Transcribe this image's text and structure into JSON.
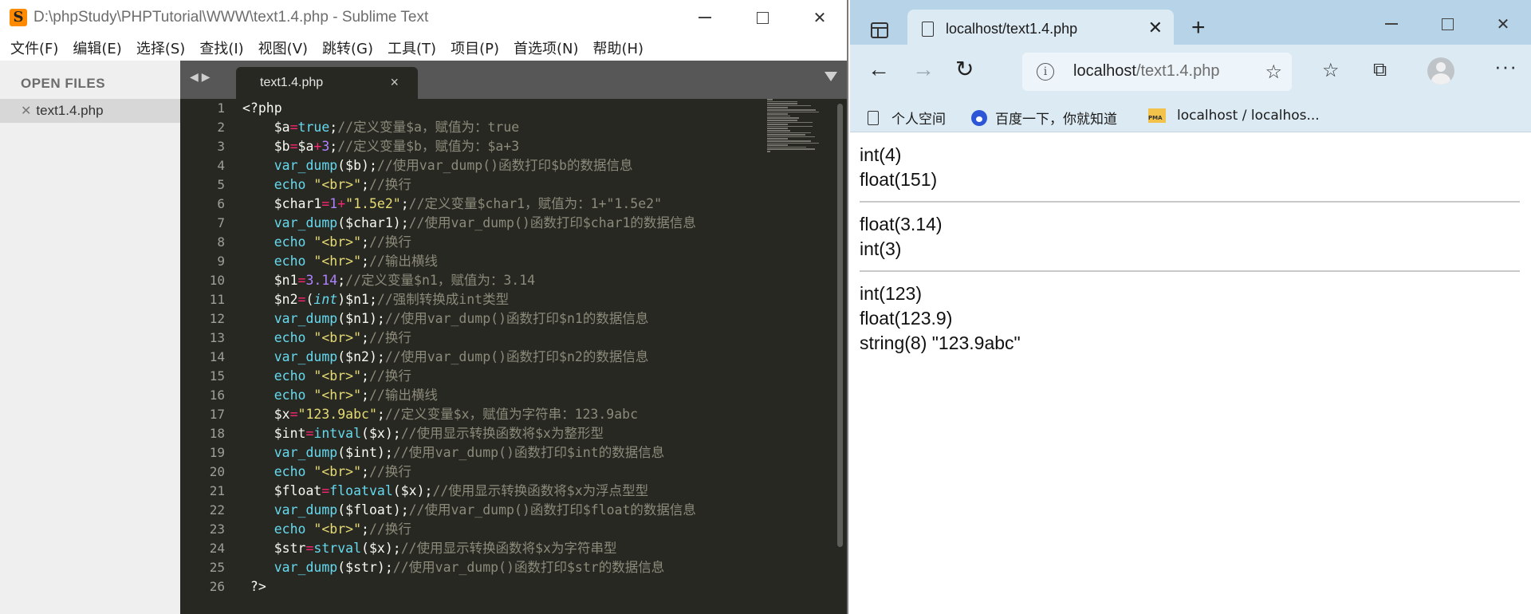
{
  "sublime": {
    "title": "D:\\phpStudy\\PHPTutorial\\WWW\\text1.4.php - Sublime Text",
    "menu": [
      "文件(F)",
      "编辑(E)",
      "选择(S)",
      "查找(I)",
      "视图(V)",
      "跳转(G)",
      "工具(T)",
      "项目(P)",
      "首选项(N)",
      "帮助(H)"
    ],
    "sidebar_header": "OPEN FILES",
    "open_file": "text1.4.php",
    "tab_label": "text1.4.php",
    "line_numbers": [
      "1",
      "2",
      "3",
      "4",
      "5",
      "6",
      "7",
      "8",
      "9",
      "10",
      "11",
      "12",
      "13",
      "14",
      "15",
      "16",
      "17",
      "18",
      "19",
      "20",
      "21",
      "22",
      "23",
      "24",
      "25",
      "26"
    ]
  },
  "edge": {
    "tab_title": "localhost/text1.4.php",
    "address_host": "localhost",
    "address_path": "/text1.4.php",
    "favorites": [
      "个人空间",
      "百度一下，你就知道",
      "localhost / localhos..."
    ],
    "output_group1": [
      "int(4)",
      "float(151)"
    ],
    "output_group2": [
      "float(3.14)",
      "int(3)"
    ],
    "output_group3": [
      "int(123)",
      "float(123.9)",
      "string(8) \"123.9abc\""
    ]
  },
  "code_lines": [
    [
      [
        "t",
        "<?php"
      ]
    ],
    [
      [
        "t",
        "    $a"
      ],
      [
        "o",
        "="
      ],
      [
        "k",
        "true"
      ],
      [
        "t",
        ";"
      ],
      [
        "c",
        "//定义变量$a，赋值为：true"
      ]
    ],
    [
      [
        "t",
        "    $b"
      ],
      [
        "o",
        "="
      ],
      [
        "t",
        "$a"
      ],
      [
        "o",
        "+"
      ],
      [
        "n",
        "3"
      ],
      [
        "t",
        ";"
      ],
      [
        "c",
        "//定义变量$b，赋值为：$a+3"
      ]
    ],
    [
      [
        "k",
        "    var_dump"
      ],
      [
        "t",
        "($b);"
      ],
      [
        "c",
        "//使用var_dump()函数打印$b的数据信息"
      ]
    ],
    [
      [
        "k",
        "    echo"
      ],
      [
        "t",
        " "
      ],
      [
        "s",
        "\"<br>\""
      ],
      [
        "t",
        ";"
      ],
      [
        "c",
        "//换行"
      ]
    ],
    [
      [
        "t",
        "    $char1"
      ],
      [
        "o",
        "="
      ],
      [
        "n",
        "1"
      ],
      [
        "o",
        "+"
      ],
      [
        "s",
        "\"1.5e2\""
      ],
      [
        "t",
        ";"
      ],
      [
        "c",
        "//定义变量$char1，赋值为：1+\"1.5e2\""
      ]
    ],
    [
      [
        "k",
        "    var_dump"
      ],
      [
        "t",
        "($char1);"
      ],
      [
        "c",
        "//使用var_dump()函数打印$char1的数据信息"
      ]
    ],
    [
      [
        "k",
        "    echo"
      ],
      [
        "t",
        " "
      ],
      [
        "s",
        "\"<br>\""
      ],
      [
        "t",
        ";"
      ],
      [
        "c",
        "//换行"
      ]
    ],
    [
      [
        "k",
        "    echo"
      ],
      [
        "t",
        " "
      ],
      [
        "s",
        "\"<hr>\""
      ],
      [
        "t",
        ";"
      ],
      [
        "c",
        "//输出横线"
      ]
    ],
    [
      [
        "t",
        "    $n1"
      ],
      [
        "o",
        "="
      ],
      [
        "n",
        "3.14"
      ],
      [
        "t",
        ";"
      ],
      [
        "c",
        "//定义变量$n1，赋值为：3.14"
      ]
    ],
    [
      [
        "t",
        "    $n2"
      ],
      [
        "o",
        "="
      ],
      [
        "t",
        "("
      ],
      [
        "it",
        "int"
      ],
      [
        "t",
        ")$n1;"
      ],
      [
        "c",
        "//强制转换成int类型"
      ]
    ],
    [
      [
        "k",
        "    var_dump"
      ],
      [
        "t",
        "($n1);"
      ],
      [
        "c",
        "//使用var_dump()函数打印$n1的数据信息"
      ]
    ],
    [
      [
        "k",
        "    echo"
      ],
      [
        "t",
        " "
      ],
      [
        "s",
        "\"<br>\""
      ],
      [
        "t",
        ";"
      ],
      [
        "c",
        "//换行"
      ]
    ],
    [
      [
        "k",
        "    var_dump"
      ],
      [
        "t",
        "($n2);"
      ],
      [
        "c",
        "//使用var_dump()函数打印$n2的数据信息"
      ]
    ],
    [
      [
        "k",
        "    echo"
      ],
      [
        "t",
        " "
      ],
      [
        "s",
        "\"<br>\""
      ],
      [
        "t",
        ";"
      ],
      [
        "c",
        "//换行"
      ]
    ],
    [
      [
        "k",
        "    echo"
      ],
      [
        "t",
        " "
      ],
      [
        "s",
        "\"<hr>\""
      ],
      [
        "t",
        ";"
      ],
      [
        "c",
        "//输出横线"
      ]
    ],
    [
      [
        "t",
        "    $x"
      ],
      [
        "o",
        "="
      ],
      [
        "s",
        "\"123.9abc\""
      ],
      [
        "t",
        ";"
      ],
      [
        "c",
        "//定义变量$x，赋值为字符串：123.9abc"
      ]
    ],
    [
      [
        "t",
        "    $int"
      ],
      [
        "o",
        "="
      ],
      [
        "k",
        "intval"
      ],
      [
        "t",
        "($x);"
      ],
      [
        "c",
        "//使用显示转换函数将$x为整形型"
      ]
    ],
    [
      [
        "k",
        "    var_dump"
      ],
      [
        "t",
        "($int);"
      ],
      [
        "c",
        "//使用var_dump()函数打印$int的数据信息"
      ]
    ],
    [
      [
        "k",
        "    echo"
      ],
      [
        "t",
        " "
      ],
      [
        "s",
        "\"<br>\""
      ],
      [
        "t",
        ";"
      ],
      [
        "c",
        "//换行"
      ]
    ],
    [
      [
        "t",
        "    $float"
      ],
      [
        "o",
        "="
      ],
      [
        "k",
        "floatval"
      ],
      [
        "t",
        "($x);"
      ],
      [
        "c",
        "//使用显示转换函数将$x为浮点型型"
      ]
    ],
    [
      [
        "k",
        "    var_dump"
      ],
      [
        "t",
        "($float);"
      ],
      [
        "c",
        "//使用var_dump()函数打印$float的数据信息"
      ]
    ],
    [
      [
        "k",
        "    echo"
      ],
      [
        "t",
        " "
      ],
      [
        "s",
        "\"<br>\""
      ],
      [
        "t",
        ";"
      ],
      [
        "c",
        "//换行"
      ]
    ],
    [
      [
        "t",
        "    $str"
      ],
      [
        "o",
        "="
      ],
      [
        "k",
        "strval"
      ],
      [
        "t",
        "($x);"
      ],
      [
        "c",
        "//使用显示转换函数将$x为字符串型"
      ]
    ],
    [
      [
        "k",
        "    var_dump"
      ],
      [
        "t",
        "($str);"
      ],
      [
        "c",
        "//使用var_dump()函数打印$str的数据信息"
      ]
    ],
    [
      [
        "t",
        " ?>"
      ]
    ]
  ]
}
